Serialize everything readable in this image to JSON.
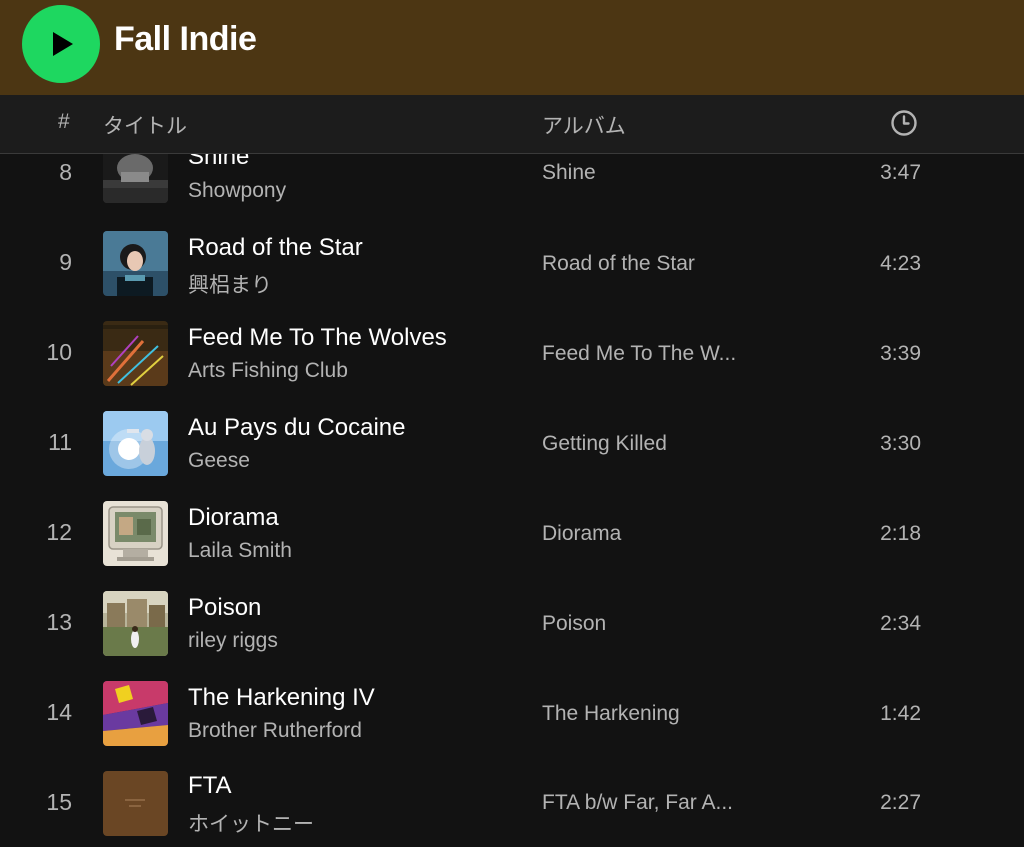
{
  "playlist": {
    "title": "Fall Indie"
  },
  "header": {
    "number": "#",
    "title": "タイトル",
    "album": "アルバム",
    "duration_icon": "clock-icon"
  },
  "colors": {
    "header_bg": "#4c3613",
    "play_button": "#1ed760",
    "background": "#121212",
    "primary_text": "#ffffff",
    "secondary_text": "#b3b3b3"
  },
  "tracks": [
    {
      "number": "8",
      "title": "Shine",
      "artist": "Showpony",
      "album": "Shine",
      "duration": "3:47"
    },
    {
      "number": "9",
      "title": "Road of the Star",
      "artist": "興梠まり",
      "album": "Road of the Star",
      "duration": "4:23"
    },
    {
      "number": "10",
      "title": "Feed Me To The Wolves",
      "artist": "Arts Fishing Club",
      "album": "Feed Me To The W...",
      "duration": "3:39"
    },
    {
      "number": "11",
      "title": "Au Pays du Cocaine",
      "artist": "Geese",
      "album": "Getting Killed",
      "duration": "3:30"
    },
    {
      "number": "12",
      "title": "Diorama",
      "artist": "Laila Smith",
      "album": "Diorama",
      "duration": "2:18"
    },
    {
      "number": "13",
      "title": "Poison",
      "artist": "riley riggs",
      "album": "Poison",
      "duration": "2:34"
    },
    {
      "number": "14",
      "title": "The Harkening IV",
      "artist": "Brother Rutherford",
      "album": "The Harkening",
      "duration": "1:42"
    },
    {
      "number": "15",
      "title": "FTA",
      "artist": "ホイットニー",
      "album": "FTA b/w Far, Far A...",
      "duration": "2:27"
    }
  ]
}
